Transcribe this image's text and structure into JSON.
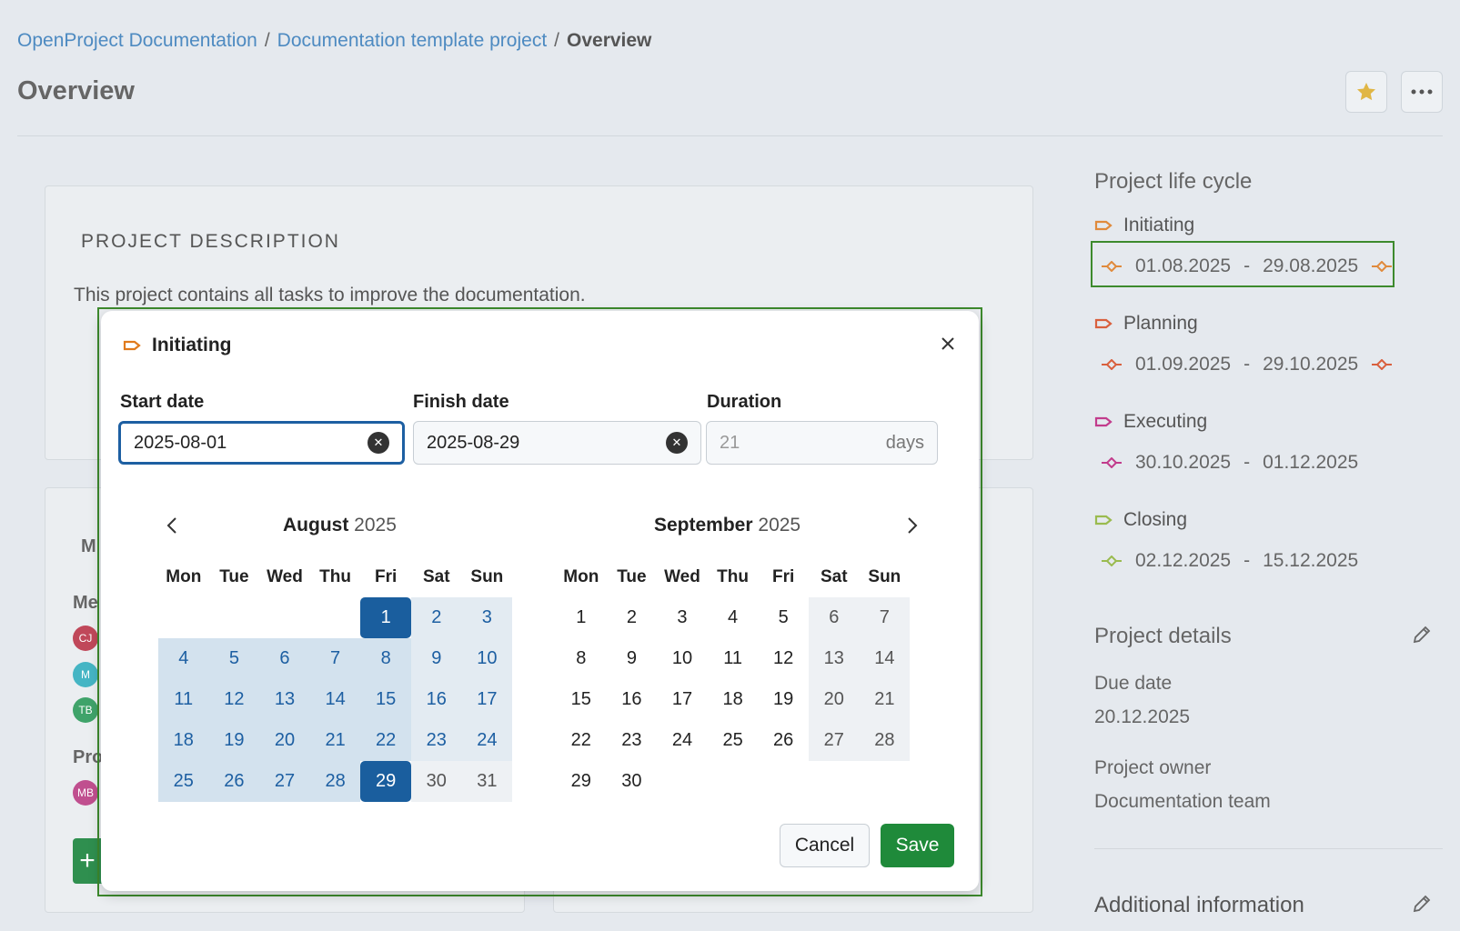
{
  "breadcrumb": {
    "items": [
      "OpenProject Documentation",
      "Documentation template project"
    ],
    "separator": "/",
    "current": "Overview"
  },
  "page": {
    "title": "Overview"
  },
  "description_card": {
    "title": "PROJECT DESCRIPTION",
    "text": "This project contains all tasks to improve the documentation."
  },
  "members_card": {
    "partial_title": "M",
    "members_label_partial": "Me",
    "avatars": [
      {
        "initials": "CJ",
        "color": "#c0485a"
      },
      {
        "initials": "M",
        "color": "#45b5c4"
      },
      {
        "initials": "TB",
        "color": "#3fa36a"
      }
    ],
    "project_label_partial": "Pro",
    "owner_avatar": {
      "initials": "MB",
      "color": "#c04f8f"
    },
    "add_label": "+"
  },
  "sidebar": {
    "lifecycle_title": "Project life cycle",
    "phases": [
      {
        "name": "Initiating",
        "start": "01.08.2025",
        "end": "29.08.2025",
        "color": "#e08a3c",
        "has_end_gate": true
      },
      {
        "name": "Planning",
        "start": "01.09.2025",
        "end": "29.10.2025",
        "color": "#d9603e",
        "has_end_gate": true
      },
      {
        "name": "Executing",
        "start": "30.10.2025",
        "end": "01.12.2025",
        "color": "#c23c8c",
        "has_end_gate": false
      },
      {
        "name": "Closing",
        "start": "02.12.2025",
        "end": "15.12.2025",
        "color": "#9abb4f",
        "has_end_gate": false
      }
    ],
    "range_sep": "-",
    "details_title": "Project details",
    "due_date_label": "Due date",
    "due_date_value": "20.12.2025",
    "owner_label": "Project owner",
    "owner_value": "Documentation team",
    "additional_title": "Additional information"
  },
  "dialog": {
    "title": "Initiating",
    "title_icon_color": "#e07a1c",
    "start_label": "Start date",
    "start_value": "2025-08-01",
    "finish_label": "Finish date",
    "finish_value": "2025-08-29",
    "duration_label": "Duration",
    "duration_value": "21",
    "duration_unit": "days",
    "weekdays": [
      "Mon",
      "Tue",
      "Wed",
      "Thu",
      "Fri",
      "Sat",
      "Sun"
    ],
    "months": [
      {
        "name": "August",
        "year": "2025",
        "offset": 4,
        "days": 31
      },
      {
        "name": "September",
        "year": "2025",
        "offset": 0,
        "days": 30
      }
    ],
    "selected_start": 1,
    "selected_end": 29,
    "cancel_label": "Cancel",
    "save_label": "Save"
  }
}
